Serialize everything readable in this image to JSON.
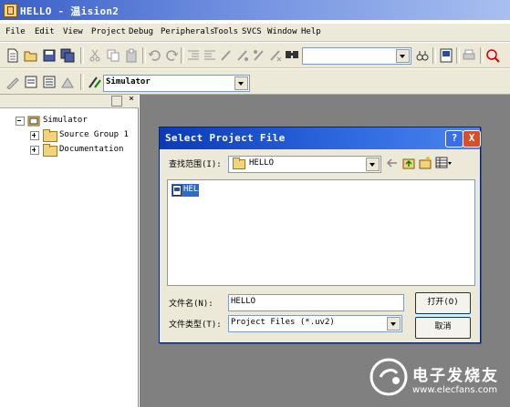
{
  "window": {
    "title": "HELLO  - 温ision2"
  },
  "menu": {
    "items": [
      "File",
      "Edit",
      "View",
      "Project",
      "Debug",
      "Peripherals",
      "Tools",
      "SVCS",
      "Window",
      "Help"
    ]
  },
  "toolbar": {
    "target_select": "Simulator"
  },
  "project_tree": {
    "root": "Simulator",
    "children": [
      "Source Group 1",
      "Documentation"
    ]
  },
  "dialog": {
    "title": "Select Project File",
    "look_in_label": "查找范围(I):",
    "look_in_value": "HELLO",
    "files": [
      "HELLO"
    ],
    "filename_label": "文件名(N):",
    "filename_value": "HELLO",
    "filetype_label": "文件类型(T):",
    "filetype_value": "Project Files (*.uv2)",
    "open_label": "打开(O)",
    "cancel_label": "取消",
    "help_glyph": "?",
    "close_glyph": "X"
  },
  "watermark": {
    "brand": "电子发烧友",
    "url": "www.elecfans.com"
  }
}
